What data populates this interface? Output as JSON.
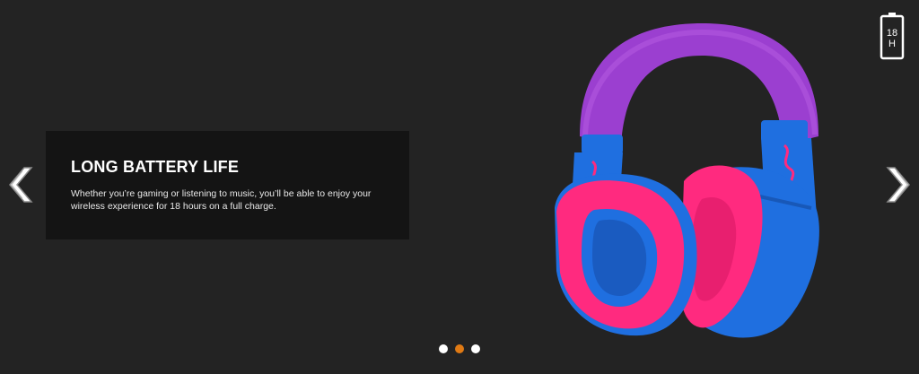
{
  "slide": {
    "title": "LONG BATTERY LIFE",
    "body": "Whether you’re gaming or listening to music, you’ll be able to enjoy your wireless experience for 18 hours on a full charge."
  },
  "battery_badge": {
    "line1": "18",
    "line2": "H"
  },
  "navigation": {
    "prev_icon": "chevron-left-icon",
    "next_icon": "chevron-right-icon",
    "dots": [
      {
        "active": false
      },
      {
        "active": true
      },
      {
        "active": false
      }
    ]
  },
  "colors": {
    "background": "#232323",
    "caption_background": "#141414",
    "active_dot": "#e07a14",
    "headset_band": "#9b3fd0",
    "headset_shell": "#1f6fe0",
    "headset_cushion": "#ff2a7f"
  },
  "product_icon": "headset-image"
}
